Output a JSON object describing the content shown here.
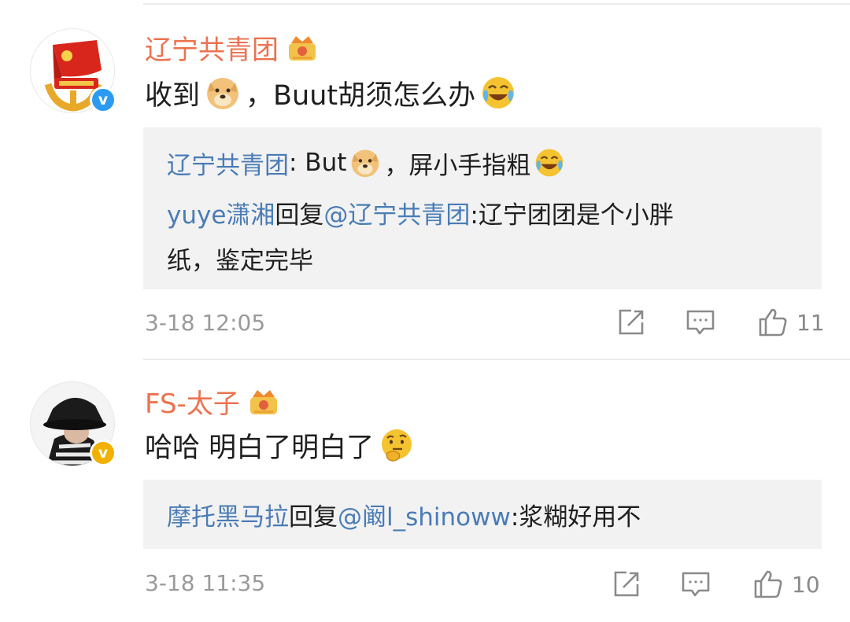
{
  "comments": [
    {
      "author": "辽宁共青团",
      "text_before": "收到",
      "text_after": "，Buut胡须怎么办",
      "quote": {
        "line1_name": "辽宁共青团",
        "line1_text_before": ": But",
        "line1_text_after": "，屏小手指粗",
        "line2_user": "yuye潇湘",
        "line2_reply_word": "回复",
        "line2_mention": "@辽宁共青团",
        "line2_text": ":辽宁团团是个小胖",
        "line3_text": "纸，鉴定完毕"
      },
      "time": "3-18 12:05",
      "likes": "11",
      "verified_color": "#2b9af3",
      "avatar_icon": "communist-youth-league-flag-icon"
    },
    {
      "author": "FS-太子",
      "text": "哈哈 明白了明白了",
      "quote": {
        "user": "摩托黑马拉",
        "reply_word": "回复",
        "mention": "@阚l_shinoww",
        "text": ":浆糊好用不"
      },
      "time": "3-18 11:35",
      "likes": "10",
      "verified_color": "#f2b100",
      "avatar_icon": "person-bucket-hat-icon"
    }
  ],
  "colors": {
    "name": "#eb7350",
    "link": "#4a7cb6",
    "quote_bg": "#f2f2f2",
    "meta": "#9a9a9a"
  },
  "badge": {
    "verified_symbol": "v"
  }
}
